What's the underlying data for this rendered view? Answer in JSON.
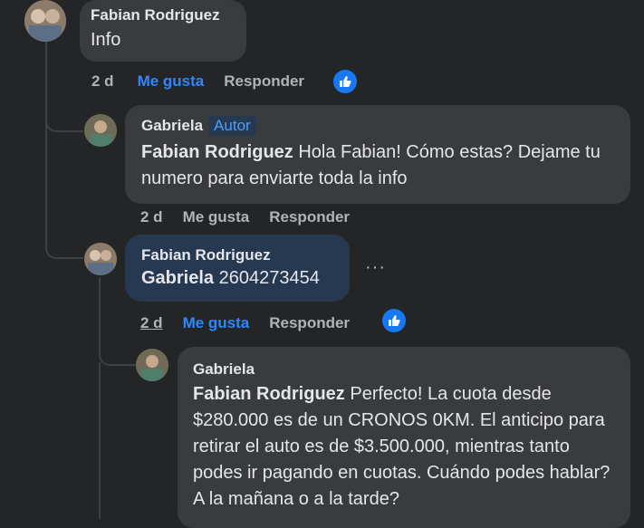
{
  "comments": [
    {
      "author": "Fabian Rodriguez",
      "badge": "",
      "text": "Info",
      "time": "2 d",
      "like": "Me gusta",
      "reply": "Responder"
    },
    {
      "author": "Gabriela",
      "badge": "Autor",
      "mention": "Fabian Rodriguez",
      "text": " Hola Fabian! Cómo estas? Dejame tu numero para enviarte toda la info",
      "time": "2 d",
      "like": "Me gusta",
      "reply": "Responder"
    },
    {
      "author": "Fabian Rodriguez",
      "badge": "",
      "mention": "Gabriela",
      "text": " 2604273454",
      "time": "2 d",
      "like": "Me gusta",
      "reply": "Responder",
      "more": "···"
    },
    {
      "author": "Gabriela",
      "badge": "",
      "mention": "Fabian Rodriguez",
      "text": " Perfecto! La cuota desde $280.000 es de un CRONOS 0KM. El anticipo para retirar el auto es de $3.500.000, mientras tanto podes ir pagando en cuotas. Cuándo podes hablar? A la mañana o a la tarde?"
    }
  ],
  "colors": {
    "background": "#242526",
    "bubble": "#3a3b3c",
    "highlighted_bubble": "#263951",
    "accent": "#2d88ff"
  },
  "icons": [
    "like-reaction-icon",
    "more-options-icon"
  ]
}
